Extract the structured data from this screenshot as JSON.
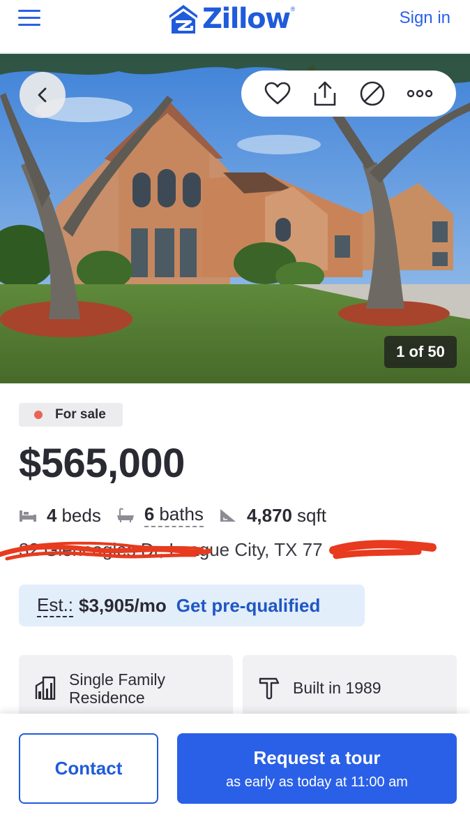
{
  "header": {
    "logo_text": "Zillow",
    "logo_reg": "®",
    "signin_label": "Sign in"
  },
  "gallery": {
    "counter": "1 of 50",
    "actions": [
      "heart-icon",
      "share-icon",
      "hide-icon",
      "more-icon"
    ]
  },
  "listing": {
    "status": "For sale",
    "status_color": "#e86456",
    "price": "$565,000",
    "beds_num": "4",
    "beds_label": "beds",
    "baths_num": "6",
    "baths_label": "baths",
    "sqft_num": "4,870",
    "sqft_label": "sqft",
    "address": "32   Gleneagles Dr, League City, TX 77   "
  },
  "estimate": {
    "label": "Est.:",
    "amount": "$3,905/mo",
    "cta": "Get pre-qualified"
  },
  "cards": [
    {
      "icon": "building-icon",
      "text": "Single Family Residence"
    },
    {
      "icon": "hammer-icon",
      "text": "Built in 1989"
    }
  ],
  "bottom": {
    "contact_label": "Contact",
    "tour_label": "Request a tour",
    "tour_sub": "as early as today at 11:00 am"
  },
  "colors": {
    "brand": "#1f5bdb",
    "button": "#2a60e8",
    "estimate_bg": "#e3eefb"
  }
}
